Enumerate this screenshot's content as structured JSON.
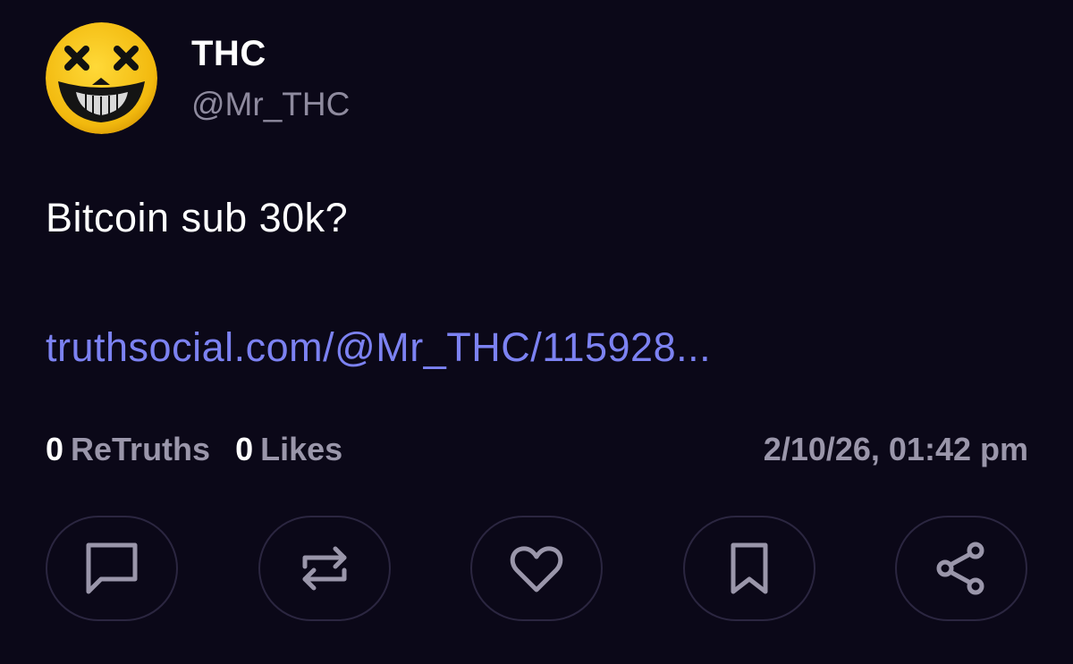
{
  "author": {
    "display_name": "THC",
    "handle": "@Mr_THC",
    "avatar_icon": "skull-smiley-avatar"
  },
  "post": {
    "text": "Bitcoin sub 30k?",
    "link": "truthsocial.com/@Mr_THC/115928..."
  },
  "stats": {
    "retruths_count": "0",
    "retruths_label": "ReTruths",
    "likes_count": "0",
    "likes_label": "Likes",
    "timestamp": "2/10/26, 01:42 pm"
  },
  "actions": [
    {
      "name": "reply",
      "icon": "comment-icon"
    },
    {
      "name": "retruth",
      "icon": "repost-icon"
    },
    {
      "name": "like",
      "icon": "heart-icon"
    },
    {
      "name": "bookmark",
      "icon": "bookmark-icon"
    },
    {
      "name": "share",
      "icon": "share-icon"
    }
  ],
  "colors": {
    "background": "#0b0818",
    "link": "#7c82f2",
    "muted": "#9a96aa",
    "button_border": "#2b2640",
    "avatar_yellow": "#f2c318"
  }
}
